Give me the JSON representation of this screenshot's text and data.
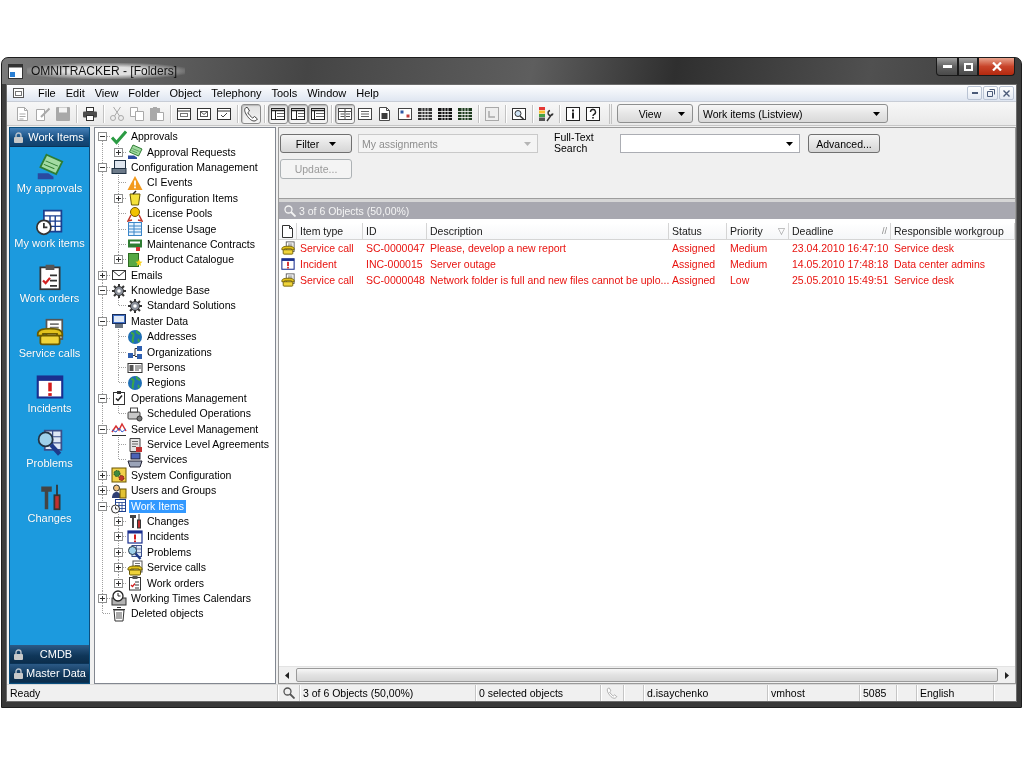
{
  "window": {
    "title": "OMNITRACKER - [Folders]"
  },
  "menu": [
    "File",
    "Edit",
    "View",
    "Folder",
    "Object",
    "Telephony",
    "Tools",
    "Window",
    "Help"
  ],
  "toolbar": {
    "groups": [
      [
        {
          "pressed": false,
          "disabled": true
        },
        {
          "pressed": false,
          "disabled": true
        },
        {
          "pressed": false,
          "disabled": true
        }
      ],
      [
        {
          "pressed": false,
          "disabled": false
        }
      ],
      [
        {
          "pressed": false,
          "disabled": true
        },
        {
          "pressed": false,
          "disabled": true
        },
        {
          "pressed": false,
          "disabled": true
        }
      ],
      [
        {
          "pressed": false,
          "disabled": false
        },
        {
          "pressed": false,
          "disabled": false
        },
        {
          "pressed": false,
          "disabled": false
        }
      ],
      [
        {
          "pressed": true,
          "disabled": false
        }
      ],
      [
        {
          "pressed": true,
          "disabled": false
        },
        {
          "pressed": true,
          "disabled": false
        },
        {
          "pressed": true,
          "disabled": false
        }
      ],
      [
        {
          "pressed": true,
          "disabled": false
        },
        {
          "pressed": false,
          "disabled": false
        },
        {
          "pressed": false,
          "disabled": false
        },
        {
          "pressed": false,
          "disabled": false
        },
        {
          "pressed": false,
          "disabled": false
        },
        {
          "pressed": false,
          "disabled": false
        },
        {
          "pressed": false,
          "disabled": false
        }
      ],
      [
        {
          "pressed": false,
          "disabled": true
        }
      ],
      [
        {
          "pressed": false,
          "disabled": false
        }
      ],
      [
        {
          "pressed": false,
          "disabled": false
        }
      ],
      [
        {
          "pressed": false,
          "disabled": false
        },
        {
          "pressed": false,
          "disabled": false
        }
      ]
    ],
    "view_button": "View",
    "view_select": "Work items (Listview)"
  },
  "sidebar": {
    "groups": [
      {
        "label": "Work Items",
        "expanded": true,
        "items": [
          {
            "label": "My approvals",
            "selected": false
          },
          {
            "label": "My work items",
            "selected": false
          },
          {
            "label": "Work orders",
            "selected": false
          },
          {
            "label": "Service calls",
            "selected": false
          },
          {
            "label": "Incidents",
            "selected": false
          },
          {
            "label": "Problems",
            "selected": false
          },
          {
            "label": "Changes",
            "selected": false
          }
        ]
      },
      {
        "label": "CMDB",
        "expanded": false
      },
      {
        "label": "Master Data",
        "expanded": false
      }
    ]
  },
  "tree": [
    {
      "label": "Approvals",
      "expanded": true,
      "selected": false,
      "children": [
        {
          "label": "Approval Requests",
          "expanded": false,
          "selected": false
        }
      ]
    },
    {
      "label": "Configuration Management",
      "expanded": true,
      "selected": false,
      "children": [
        {
          "label": "CI Events",
          "selected": false
        },
        {
          "label": "Configuration Items",
          "expanded": false,
          "selected": false
        },
        {
          "label": "License Pools",
          "selected": false
        },
        {
          "label": "License Usage",
          "selected": false
        },
        {
          "label": "Maintenance Contracts",
          "selected": false
        },
        {
          "label": "Product Catalogue",
          "expanded": false,
          "selected": false
        }
      ]
    },
    {
      "label": "Emails",
      "expanded": false,
      "selected": false
    },
    {
      "label": "Knowledge Base",
      "expanded": true,
      "selected": false,
      "children": [
        {
          "label": "Standard Solutions",
          "selected": false
        }
      ]
    },
    {
      "label": "Master Data",
      "expanded": true,
      "selected": false,
      "children": [
        {
          "label": "Addresses",
          "selected": false
        },
        {
          "label": "Organizations",
          "selected": false
        },
        {
          "label": "Persons",
          "selected": false
        },
        {
          "label": "Regions",
          "selected": false
        }
      ]
    },
    {
      "label": "Operations Management",
      "expanded": true,
      "selected": false,
      "children": [
        {
          "label": "Scheduled Operations",
          "selected": false
        }
      ]
    },
    {
      "label": "Service Level Management",
      "expanded": true,
      "selected": false,
      "children": [
        {
          "label": "Service Level Agreements",
          "selected": false
        },
        {
          "label": "Services",
          "selected": false
        }
      ]
    },
    {
      "label": "System Configuration",
      "expanded": false,
      "selected": false
    },
    {
      "label": "Users and Groups",
      "expanded": false,
      "selected": false
    },
    {
      "label": "Work Items",
      "expanded": true,
      "selected": true,
      "children": [
        {
          "label": "Changes",
          "expanded": false,
          "selected": false
        },
        {
          "label": "Incidents",
          "expanded": false,
          "selected": false
        },
        {
          "label": "Problems",
          "expanded": false,
          "selected": false
        },
        {
          "label": "Service calls",
          "expanded": false,
          "selected": false
        },
        {
          "label": "Work orders",
          "expanded": false,
          "selected": false
        }
      ]
    },
    {
      "label": "Working Times Calendars",
      "expanded": false,
      "selected": false
    },
    {
      "label": "Deleted objects",
      "selected": false
    }
  ],
  "filter": {
    "filter_button": "Filter",
    "assignment_select": {
      "value": "My assignments",
      "disabled": true
    },
    "search_label": "Full-Text Search",
    "advanced_button": "Advanced...",
    "update_button": {
      "label": "Update...",
      "disabled": true
    }
  },
  "result_bar": "3 of 6 Objects (50,00%)",
  "table": {
    "columns": [
      {
        "label": "Item type"
      },
      {
        "label": "ID"
      },
      {
        "label": "Description"
      },
      {
        "label": "Status"
      },
      {
        "label": "Priority",
        "indicator": "▽"
      },
      {
        "label": "Deadline",
        "indicator": "//"
      },
      {
        "label": "Responsible workgroup"
      }
    ],
    "rows": [
      {
        "kind": "service_call",
        "selected": false,
        "cells": [
          "Service call",
          "SC-0000047",
          "Please, develop a new report",
          "Assigned",
          "Medium",
          "23.04.2010 16:47:10",
          "Service desk"
        ]
      },
      {
        "kind": "incident",
        "selected": false,
        "cells": [
          "Incident",
          "INC-000015",
          "Server outage",
          "Assigned",
          "Medium",
          "14.05.2010 17:48:18",
          "Data center admins"
        ]
      },
      {
        "kind": "service_call",
        "selected": false,
        "cells": [
          "Service call",
          "SC-0000048",
          "Network folder is full and new files cannot be uplo...",
          "Assigned",
          "Low",
          "25.05.2010 15:49:51",
          "Service desk"
        ]
      }
    ]
  },
  "status_bar": {
    "message": "Ready",
    "objects": "3 of 6 Objects (50,00%)",
    "selection": "0 selected objects",
    "user": "d.isaychenko",
    "host": "vmhost",
    "port": "5085",
    "language": "English"
  }
}
